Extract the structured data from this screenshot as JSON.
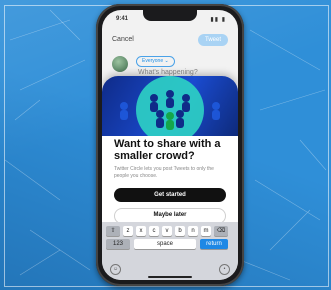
{
  "status_bar": {
    "time": "9:41",
    "indicators": "▮▮ ▮"
  },
  "compose": {
    "cancel_label": "Cancel",
    "tweet_label": "Tweet",
    "audience_label": "Everyone ⌄",
    "prompt_placeholder": "What's happening?"
  },
  "modal": {
    "headline": "Want to share with a smaller crowd?",
    "description": "Twitter Circle lets you post Tweets to only the people you choose.",
    "primary_button": "Get started",
    "secondary_button": "Maybe later"
  },
  "keyboard": {
    "row3": [
      "⇧",
      "z",
      "x",
      "c",
      "v",
      "b",
      "n",
      "m",
      "⌫"
    ],
    "key_123": "123",
    "key_space": "space",
    "key_return": "return",
    "icon_emoji": "emoji-icon",
    "icon_mic": "microphone-icon"
  },
  "colors": {
    "background": "#2f8fd8",
    "twitter_blue": "#1d8ee6",
    "hero": "#1a4bd0",
    "primary_button": "#111111"
  }
}
